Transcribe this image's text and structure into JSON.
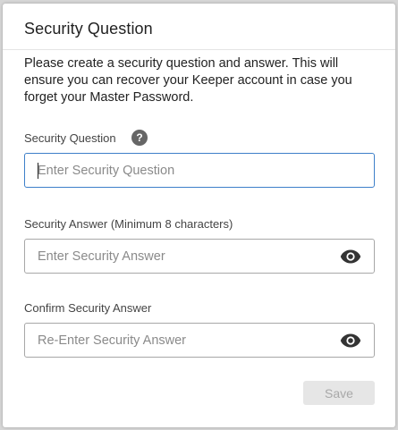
{
  "dialog": {
    "title": "Security Question",
    "intro": "Please create a security question and answer. This will ensure you can recover your Keeper account in case you forget your Master Password."
  },
  "question": {
    "label": "Security Question",
    "help_icon": "?",
    "placeholder": "Enter Security Question",
    "value": ""
  },
  "answer": {
    "label": "Security Answer (Minimum 8 characters)",
    "placeholder": "Enter Security Answer",
    "value": "",
    "icon": "eye-icon"
  },
  "confirm": {
    "label": "Confirm Security Answer",
    "placeholder": "Re-Enter Security Answer",
    "value": "",
    "icon": "eye-icon"
  },
  "actions": {
    "save_label": "Save",
    "save_enabled": false
  },
  "colors": {
    "focus_border": "#3d7fc9",
    "icon": "#333333",
    "disabled_button_bg": "#e6e6e6",
    "disabled_button_text": "#a8a8a8"
  }
}
